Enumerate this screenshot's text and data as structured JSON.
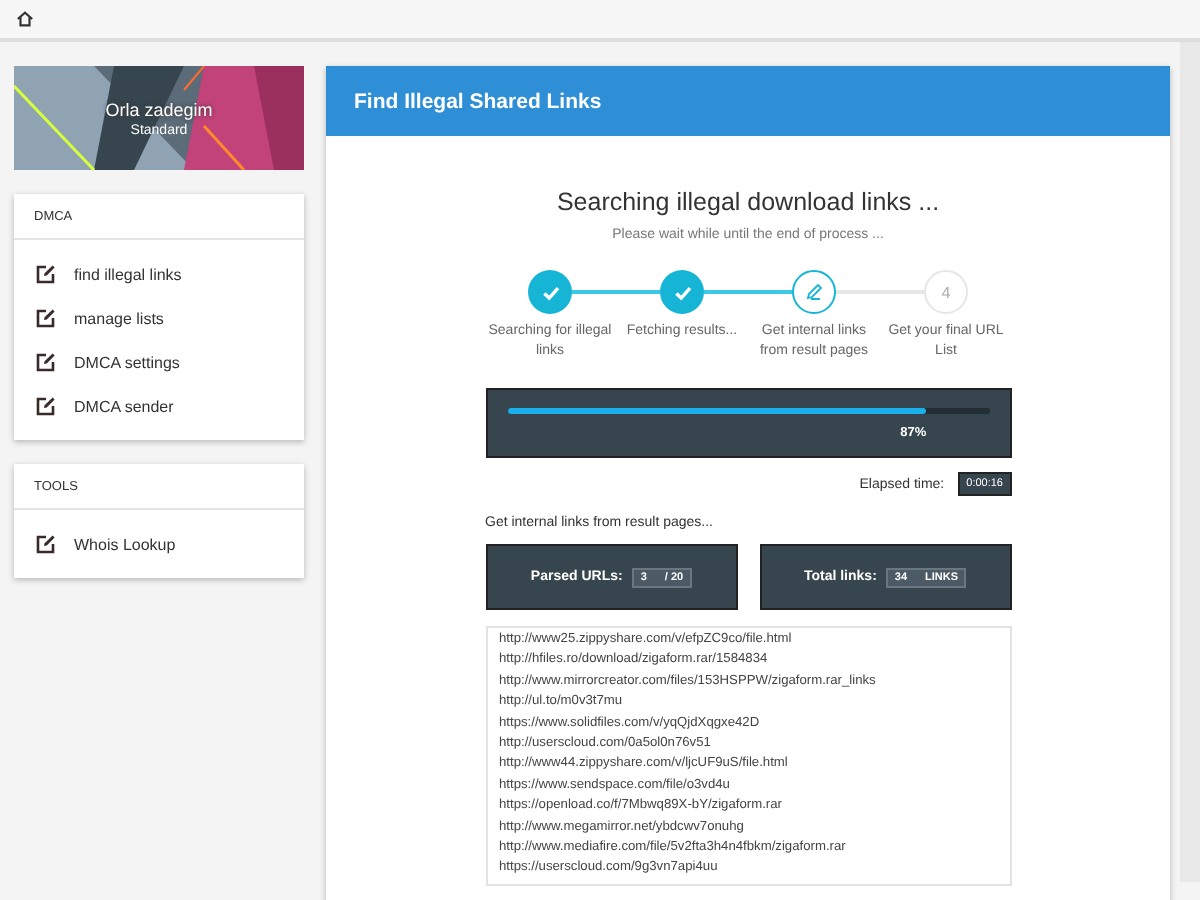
{
  "profile": {
    "name": "Orla zadegim",
    "plan": "Standard"
  },
  "sidebar_sections": [
    {
      "title": "DMCA",
      "items": [
        {
          "label": "find illegal links"
        },
        {
          "label": "manage lists"
        },
        {
          "label": "DMCA settings"
        },
        {
          "label": "DMCA sender"
        }
      ]
    },
    {
      "title": "TOOLS",
      "items": [
        {
          "label": "Whois Lookup"
        }
      ]
    }
  ],
  "panel": {
    "title": "Find Illegal Shared Links",
    "heading": "Searching illegal download links ...",
    "subtitle": "Please wait while until the end of process ...",
    "steps": [
      {
        "completed": true,
        "current": false,
        "label": "Searching for illegal links"
      },
      {
        "completed": true,
        "current": false,
        "label": "Fetching results..."
      },
      {
        "completed": false,
        "current": true,
        "label": "Get internal links from result pages"
      },
      {
        "completed": false,
        "current": false,
        "number": "4",
        "label": "Get your final URL List"
      }
    ],
    "progress": {
      "level": 0.87,
      "reading": "87%"
    },
    "elapsed": {
      "label": "Elapsed time:",
      "value": "0:00:16"
    },
    "phase": "Get internal links from result pages...",
    "stats": [
      {
        "label": "Parsed URLs:",
        "value": "3",
        "suffix": "/ 20"
      },
      {
        "label": "Total links:",
        "value": "34",
        "suffix": "LINKS"
      }
    ],
    "urls": [
      "http://www25.zippyshare.com/v/efpZC9co/file.html",
      "http://hfiles.ro/download/zigaform.rar/1584834",
      "http://www.mirrorcreator.com/files/153HSPPW/zigaform.rar_links",
      "http://ul.to/m0v3t7mu",
      "https://www.solidfiles.com/v/yqQjdXqgxe42D",
      "http://userscloud.com/0a5ol0n76v51",
      "http://www44.zippyshare.com/v/ljcUF9uS/file.html",
      "https://www.sendspace.com/file/o3vd4u",
      "https://openload.co/f/7Mbwq89X-bY/zigaform.rar",
      "http://www.megamirror.net/ybdcwv7onuhg",
      "http://www.mediafire.com/file/5v2fta3h4n4fbkm/zigaform.rar",
      "https://userscloud.com/9g3vn7api4uu"
    ]
  }
}
